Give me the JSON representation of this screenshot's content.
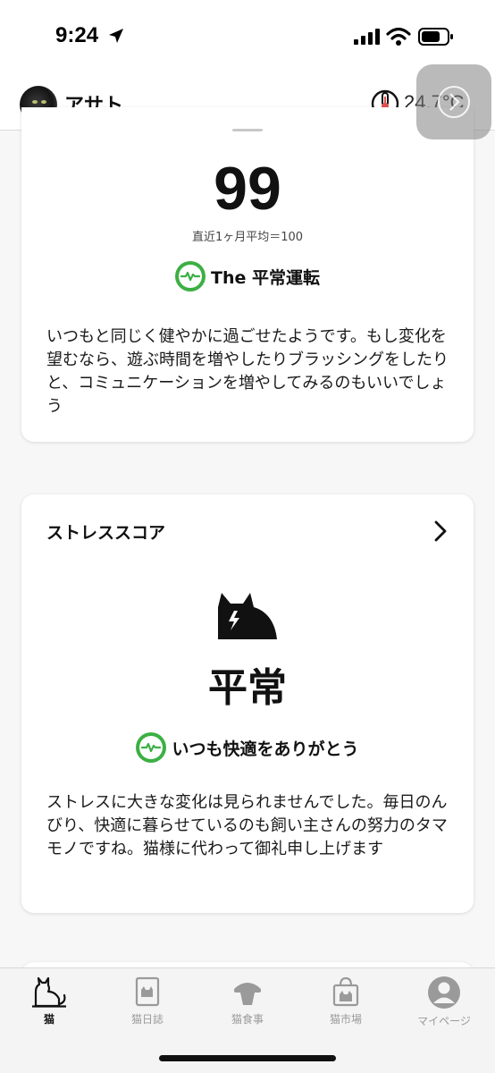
{
  "status_bar": {
    "time": "9:24"
  },
  "header": {
    "cat_name": "アサト",
    "temperature": "24.7°C"
  },
  "score_card": {
    "score": "99",
    "average_text": "直近1ヶ月平均＝100",
    "status_label": "The 平常運転",
    "description": "いつもと同じく健やかに過ごせたようです。もし変化を望むなら、遊ぶ時間を増やしたりブラッシングをしたりと、コミュニケーションを増やしてみるのもいいでしょう"
  },
  "stress_card": {
    "title": "ストレススコア",
    "level": "平常",
    "status_label": "いつも快適をありがとう",
    "description": "ストレスに大きな変化は見られませんでした。毎日のんびり、快適に暮らせているのも飼い主さんの努力のタマモノですね。猫様に代わって御礼申し上げます"
  },
  "tabs": [
    {
      "label": "猫",
      "icon": "cat-icon",
      "active": true
    },
    {
      "label": "猫日誌",
      "icon": "diary-icon",
      "active": false
    },
    {
      "label": "猫食事",
      "icon": "food-bowl-icon",
      "active": false
    },
    {
      "label": "猫市場",
      "icon": "shopping-bag-icon",
      "active": false
    },
    {
      "label": "マイページ",
      "icon": "profile-icon",
      "active": false
    }
  ],
  "colors": {
    "accent_green": "#3cb043",
    "background": "#f7f7f7",
    "card": "#ffffff"
  }
}
